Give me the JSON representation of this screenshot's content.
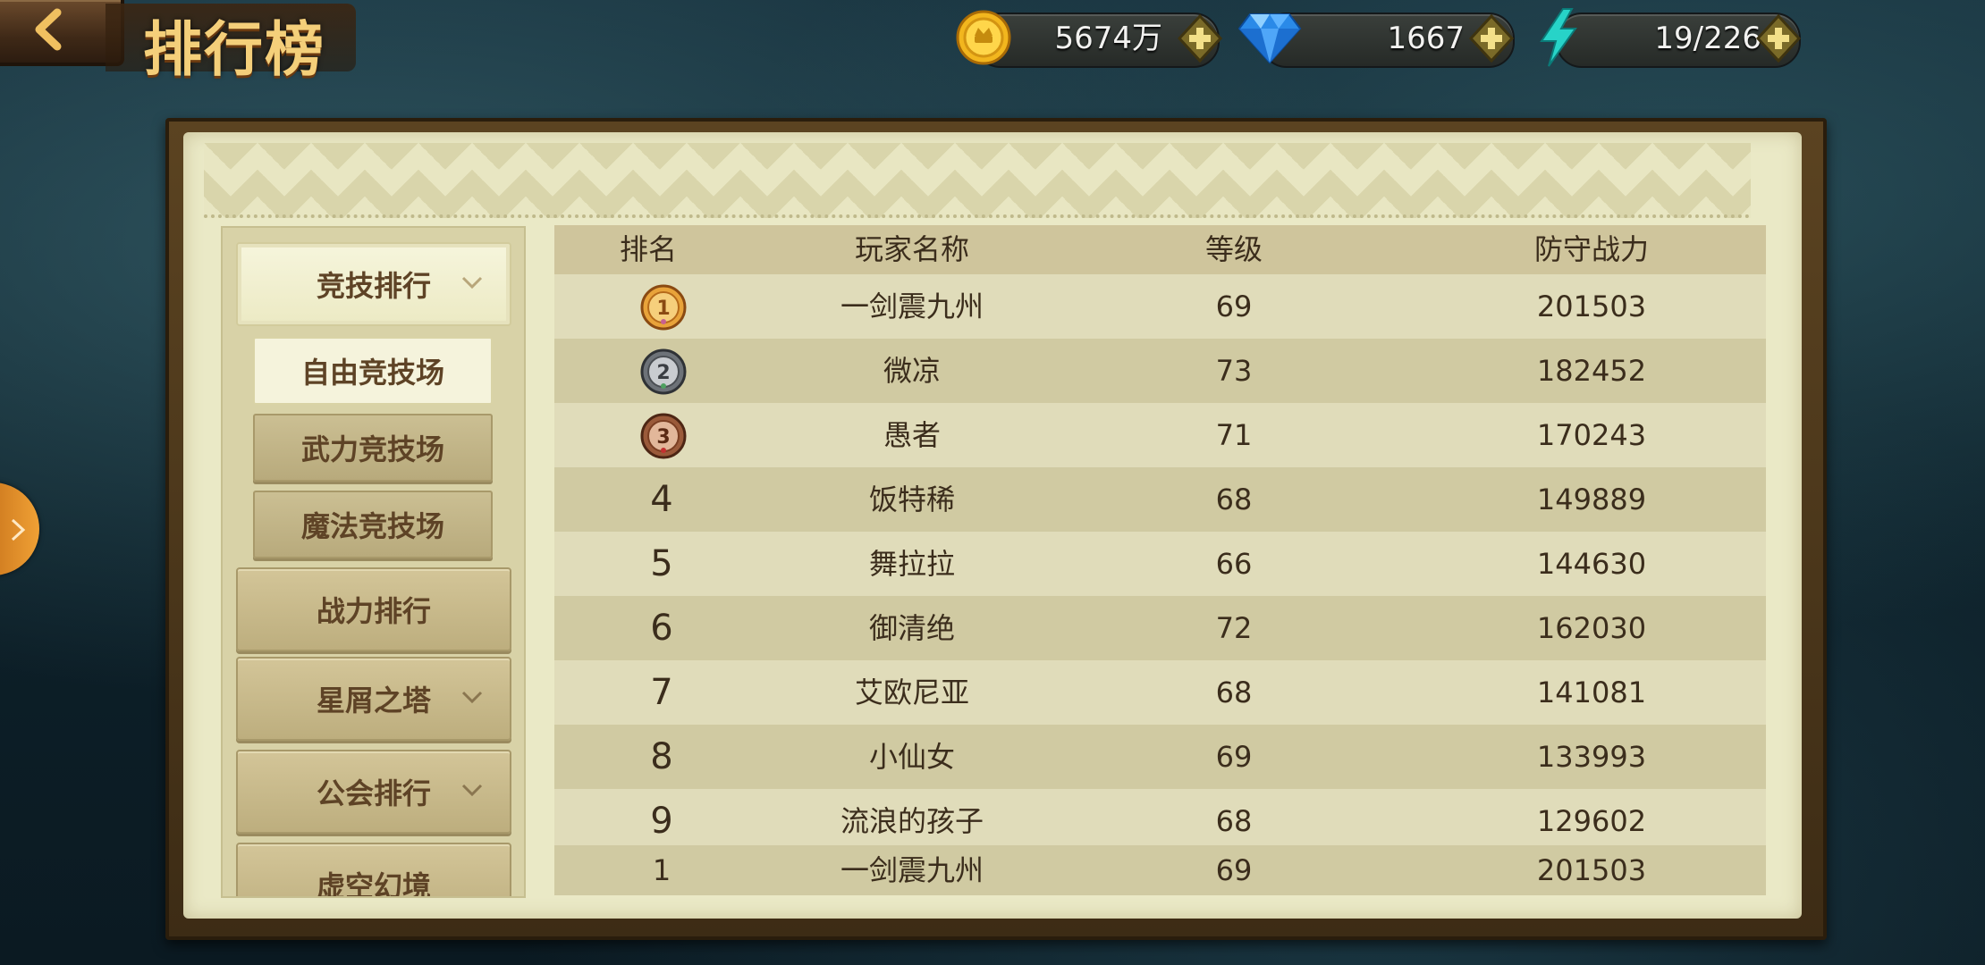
{
  "header": {
    "title": "排行榜"
  },
  "resources": {
    "gold": "5674万",
    "diamonds": "1667",
    "stamina": "19/226"
  },
  "sidebar": {
    "categories": [
      {
        "label": "竞技排行",
        "expandable": true
      },
      {
        "label": "战力排行",
        "expandable": false
      },
      {
        "label": "星屑之塔",
        "expandable": true
      },
      {
        "label": "公会排行",
        "expandable": true
      },
      {
        "label": "虚空幻境",
        "expandable": false
      }
    ],
    "sub_items": [
      {
        "label": "自由竞技场"
      },
      {
        "label": "武力竞技场"
      },
      {
        "label": "魔法竞技场"
      }
    ]
  },
  "table": {
    "headers": [
      "排名",
      "玩家名称",
      "等级",
      "防守战力"
    ],
    "rows": [
      {
        "rank": "1",
        "name": "一剑震九州",
        "level": "69",
        "power": "201503"
      },
      {
        "rank": "2",
        "name": "微凉",
        "level": "73",
        "power": "182452"
      },
      {
        "rank": "3",
        "name": "愚者",
        "level": "71",
        "power": "170243"
      },
      {
        "rank": "4",
        "name": "饭特稀",
        "level": "68",
        "power": "149889"
      },
      {
        "rank": "5",
        "name": "舞拉拉",
        "level": "66",
        "power": "144630"
      },
      {
        "rank": "6",
        "name": "御清绝",
        "level": "72",
        "power": "162030"
      },
      {
        "rank": "7",
        "name": "艾欧尼亚",
        "level": "68",
        "power": "141081"
      },
      {
        "rank": "8",
        "name": "小仙女",
        "level": "69",
        "power": "133993"
      },
      {
        "rank": "9",
        "name": "流浪的孩子",
        "level": "68",
        "power": "129602"
      },
      {
        "rank": "1",
        "name": "一剑震九州",
        "level": "69",
        "power": "201503"
      }
    ]
  },
  "colors": {
    "gold_medal": "#e8a33a",
    "silver_medal": "#6d7278",
    "bronze_medal": "#9a5a3a",
    "title_text": "#f4cf7a",
    "side_tab": "#e8902a"
  },
  "icons": {
    "back": "back-arrow-icon",
    "gold": "gold-coin-icon",
    "diamond": "diamond-icon",
    "stamina": "lightning-icon",
    "add": "plus-icon",
    "expand": "chevron-down-icon"
  }
}
